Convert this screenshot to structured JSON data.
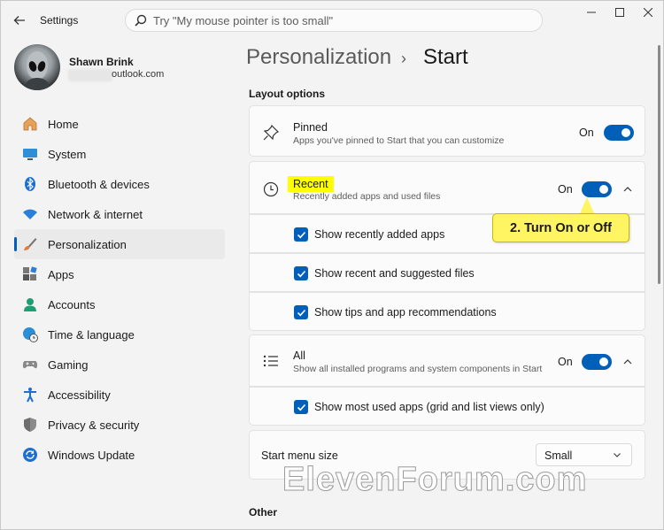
{
  "app": {
    "title": "Settings"
  },
  "search": {
    "placeholder": "Try \"My mouse pointer is too small\""
  },
  "profile": {
    "name": "Shawn Brink",
    "email_visible": "outlook.com"
  },
  "nav": {
    "items": [
      {
        "label": "Home",
        "icon": "home-icon"
      },
      {
        "label": "System",
        "icon": "monitor-icon"
      },
      {
        "label": "Bluetooth & devices",
        "icon": "bluetooth-icon"
      },
      {
        "label": "Network & internet",
        "icon": "wifi-icon"
      },
      {
        "label": "Personalization",
        "icon": "brush-icon",
        "active": true
      },
      {
        "label": "Apps",
        "icon": "apps-icon"
      },
      {
        "label": "Accounts",
        "icon": "person-icon"
      },
      {
        "label": "Time & language",
        "icon": "globe-clock-icon"
      },
      {
        "label": "Gaming",
        "icon": "gamepad-icon"
      },
      {
        "label": "Accessibility",
        "icon": "accessibility-icon"
      },
      {
        "label": "Privacy & security",
        "icon": "shield-icon"
      },
      {
        "label": "Windows Update",
        "icon": "update-icon"
      }
    ]
  },
  "header": {
    "parent": "Personalization",
    "separator": "›",
    "current": "Start"
  },
  "layout_options": {
    "title": "Layout options",
    "pinned": {
      "title": "Pinned",
      "subtitle": "Apps you've pinned to Start that you can customize",
      "state": "On"
    },
    "recent": {
      "title": "Recent",
      "subtitle": "Recently added apps and used files",
      "state": "On",
      "options": [
        {
          "label": "Show recently added apps",
          "checked": true
        },
        {
          "label": "Show recent and suggested files",
          "checked": true
        },
        {
          "label": "Show tips and app recommendations",
          "checked": true
        }
      ]
    },
    "all": {
      "title": "All",
      "subtitle": "Show all installed programs and system components in Start",
      "state": "On",
      "options": [
        {
          "label": "Show most used apps (grid and list views only)",
          "checked": true
        }
      ]
    },
    "start_menu_size": {
      "label": "Start menu size",
      "value": "Small"
    }
  },
  "other": {
    "title": "Other"
  },
  "callout": {
    "text": "2. Turn On or Off"
  },
  "watermark": "ElevenForum.com",
  "colors": {
    "accent": "#005fb8",
    "highlight": "#ffff00",
    "callout_bg": "#fff462"
  }
}
